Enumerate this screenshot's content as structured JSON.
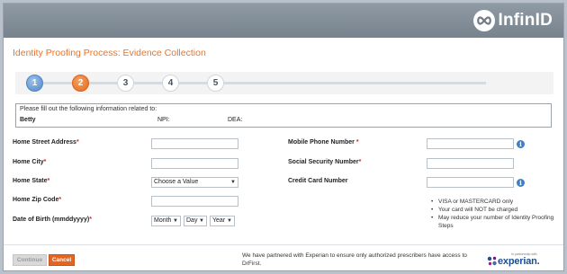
{
  "app": {
    "logo_text": "InfinID"
  },
  "page": {
    "title": "Identity Proofing Process: Evidence Collection"
  },
  "steps": [
    "1",
    "2",
    "3",
    "4",
    "5"
  ],
  "info": {
    "note": "Please fill out the following information related to:",
    "name": "Betty",
    "npi_label": "NPI:",
    "dea_label": "DEA:"
  },
  "form": {
    "street": {
      "label": "Home Street Address",
      "required": "*"
    },
    "city": {
      "label": "Home City",
      "required": "*"
    },
    "state": {
      "label": "Home State",
      "required": "*",
      "value": "Choose a Value"
    },
    "zip": {
      "label": "Home Zip Code",
      "required": "*"
    },
    "dob": {
      "label": "Date of Birth (mmddyyyy)",
      "required": "*",
      "month": "Month",
      "day": "Day",
      "year": "Year"
    },
    "mobile": {
      "label": "Mobile Phone Number",
      "required": " *"
    },
    "ssn": {
      "label": "Social Security Number",
      "required": "*"
    },
    "card": {
      "label": "Credit Card Number"
    }
  },
  "card_notes": [
    "VISA or MASTERCARD only",
    "Your card will NOT be charged",
    "May reduce your number of Identity Proofing Steps"
  ],
  "buttons": {
    "continue": "Continue",
    "cancel": "Cancel"
  },
  "footer": {
    "partner_text": "We have partnered with Experian to ensure only authorized prescribers have access to DrFirst.",
    "partner_logo_small": "In partnership with",
    "partner_logo": "experian."
  },
  "colors": {
    "accent": "#e8742a",
    "step_done": "#4f86c8",
    "step_active": "#e36a1a",
    "required": "#cc2a2a",
    "help": "#3f7fc8"
  }
}
